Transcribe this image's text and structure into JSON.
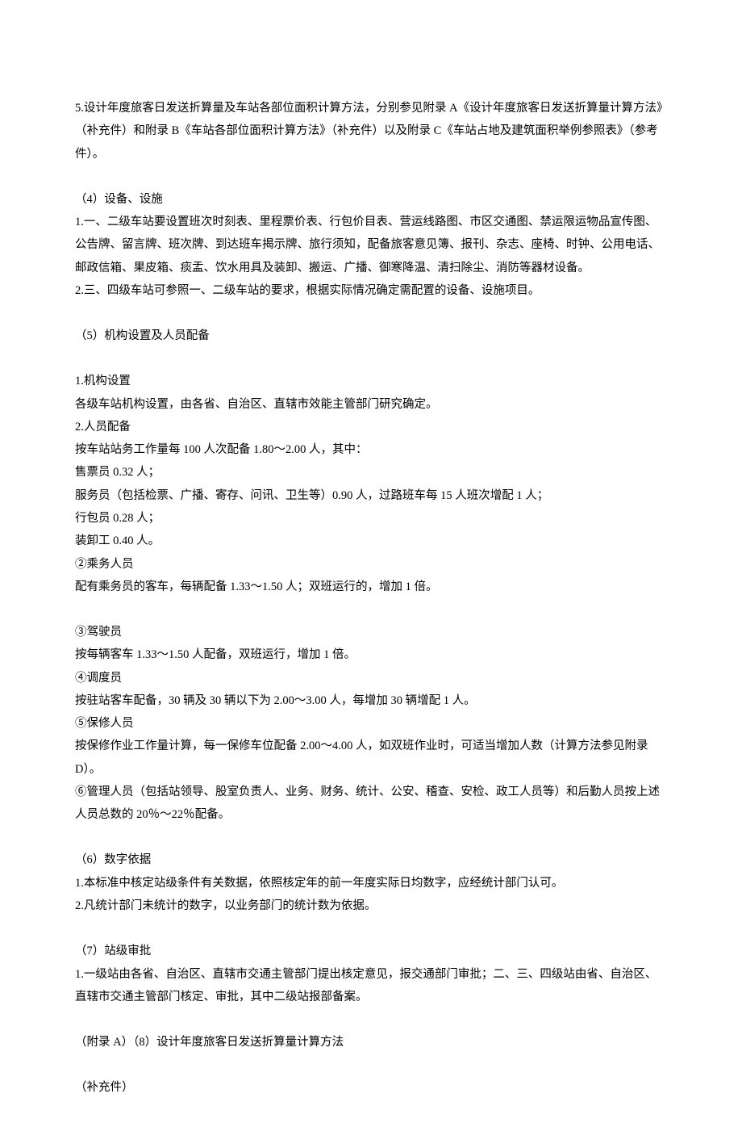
{
  "paragraphs": [
    {
      "class": "block",
      "lines": [
        "5.设计年度旅客日发送折算量及车站各部位面积计算方法，分别参见附录 A《设计年度旅客日发送折算量计算方法》（补充件）和附录 B《车站各部位面积计算方法》（补充件）以及附录 C《车站占地及建筑面积举例参照表》（参考件）。"
      ]
    },
    {
      "class": "block",
      "lines": [
        "（4）设备、设施",
        "1.一、二级车站要设置班次时刻表、里程票价表、行包价目表、营运线路图、市区交通图、禁运限运物品宣传图、公告牌、留言牌、班次牌、到达班车揭示牌、旅行须知，配备旅客意见簿、报刊、杂志、座椅、时钟、公用电话、邮政信箱、果皮箱、痰盂、饮水用具及装卸、搬运、广播、御寒降温、清扫除尘、消防等器材设备。",
        "2.三、四级车站可参照一、二级车站的要求，根据实际情况确定需配置的设备、设施项目。"
      ]
    },
    {
      "class": "block",
      "lines": [
        "（5）机构设置及人员配备"
      ]
    },
    {
      "class": "block",
      "lines": [
        "1.机构设置",
        "各级车站机构设置，由各省、自治区、直辖市效能主管部门研究确定。",
        "2.人员配备",
        "按车站站务工作量每 100 人次配备 1.80～2.00 人，其中：",
        "售票员 0.32 人；",
        "服务员（包括检票、广播、寄存、问讯、卫生等）0.90 人，过路班车每 15 人班次增配 1 人；",
        "行包员 0.28 人；",
        "装卸工 0.40 人。",
        "②乘务人员",
        "配有乘务员的客车，每辆配备 1.33～1.50 人；双班运行的，增加 1 倍。"
      ]
    },
    {
      "class": "block",
      "lines": [
        "③驾驶员",
        "按每辆客车 1.33～1.50 人配备，双班运行，增加 1 倍。",
        "④调度员",
        "按驻站客车配备，30 辆及 30 辆以下为 2.00～3.00 人，每增加 30 辆增配 1 人。",
        "⑤保修人员",
        "按保修作业工作量计算，每一保修车位配备 2.00～4.00 人，如双班作业时，可适当增加人数（计算方法参见附录 D）。",
        "⑥管理人员（包括站领导、股室负责人、业务、财务、统计、公安、稽查、安检、政工人员等）和后勤人员按上述人员总数的 20％～22％配备。"
      ]
    },
    {
      "class": "block",
      "lines": [
        "（6）数字依据",
        "1.本标准中核定站级条件有关数据，依照核定年的前一年度实际日均数字，应经统计部门认可。",
        "2.凡统计部门未统计的数字，以业务部门的统计数为依据。"
      ]
    },
    {
      "class": "block",
      "lines": [
        "（7）站级审批",
        "1.一级站由各省、自治区、直辖市交通主管部门提出核定意见，报交通部门审批；二、三、四级站由省、自治区、直辖市交通主管部门核定、审批，其中二级站报部备案。"
      ]
    },
    {
      "class": "block",
      "lines": [
        "（附录 A）（8）设计年度旅客日发送折算量计算方法"
      ]
    },
    {
      "class": "block",
      "lines": [
        "（补充件）"
      ]
    }
  ]
}
